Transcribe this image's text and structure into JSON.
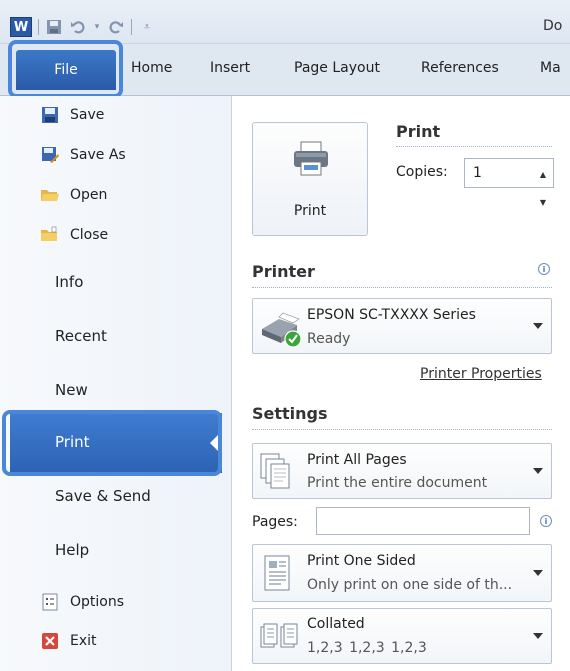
{
  "window": {
    "title_partial": "Do"
  },
  "quick_access": {
    "app_logo": "W",
    "icons": [
      "save-icon",
      "undo-icon",
      "redo-icon",
      "customize-icon"
    ]
  },
  "ribbon": {
    "tabs": [
      {
        "label": "File",
        "selected": true
      },
      {
        "label": "Home"
      },
      {
        "label": "Insert"
      },
      {
        "label": "Page Layout"
      },
      {
        "label": "References"
      },
      {
        "label": "Ma"
      }
    ]
  },
  "backstage": {
    "items": [
      {
        "label": "Save",
        "icon": "save-icon"
      },
      {
        "label": "Save As",
        "icon": "save-as-icon"
      },
      {
        "label": "Open",
        "icon": "open-folder-icon"
      },
      {
        "label": "Close",
        "icon": "close-folder-icon"
      },
      {
        "label": "Info"
      },
      {
        "label": "Recent"
      },
      {
        "label": "New"
      },
      {
        "label": "Print",
        "selected": true
      },
      {
        "label": "Save & Send"
      },
      {
        "label": "Help"
      },
      {
        "label": "Options",
        "icon": "options-icon"
      },
      {
        "label": "Exit",
        "icon": "exit-icon"
      }
    ]
  },
  "print": {
    "button_label": "Print",
    "heading": "Print",
    "copies_label": "Copies:",
    "copies_value": "1"
  },
  "printer": {
    "heading": "Printer",
    "name": "EPSON SC-TXXXX Series",
    "status": "Ready",
    "properties_link": "Printer Properties"
  },
  "settings": {
    "heading": "Settings",
    "range": {
      "title": "Print All Pages",
      "subtitle": "Print the entire document"
    },
    "pages_label": "Pages:",
    "pages_value": "",
    "sides": {
      "title": "Print One Sided",
      "subtitle": "Only print on one side of th..."
    },
    "collation": {
      "title": "Collated",
      "subtitle": "1,2,3   1,2,3   1,2,3"
    }
  },
  "colors": {
    "accent": "#2d62b4",
    "highlight_outline": "#4a86d9",
    "file_tab": "#2a5aa7"
  }
}
